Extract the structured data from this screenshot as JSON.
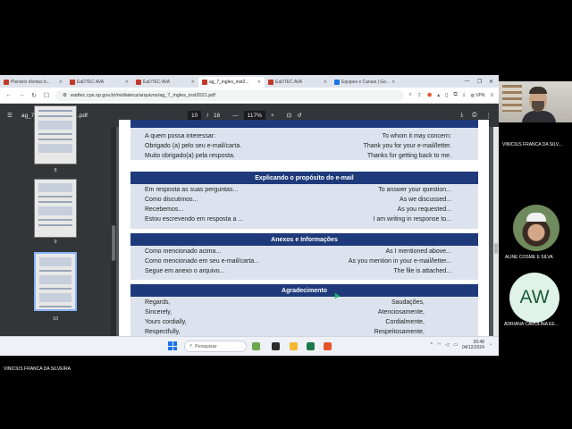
{
  "browser": {
    "tabs": [
      {
        "label": "Plenário dívidas b...",
        "active": false
      },
      {
        "label": "EaDTEC AVA",
        "active": false
      },
      {
        "label": "EaDTEC AVA",
        "active": false
      },
      {
        "label": "ag_7_ingles_inst2...",
        "active": true
      },
      {
        "label": "EaDTEC AVA",
        "active": false
      },
      {
        "label": "Equipes e Canais | Ge...",
        "active": false
      }
    ],
    "url": "eadtec.cps.sp.gov.br/midiateca/arquivos/ag_7_ingles_inst2021.pdf",
    "vpn_label": "VPN"
  },
  "pdf_viewer": {
    "file_name": "ag_7_ingles_inst2021.pdf",
    "current_page": "10",
    "page_separator": "/",
    "total_pages": "16",
    "zoom": "117%",
    "thumbnails": [
      {
        "label": "8"
      },
      {
        "label": "9"
      },
      {
        "label": "10"
      }
    ]
  },
  "document": {
    "sections": [
      {
        "heading": "",
        "rows": [
          {
            "pt": "A quem possa interessar:",
            "en": "To whom it may concern:"
          },
          {
            "pt": "Obrigado (a) pelo seu e-mail/carta.",
            "en": "Thank you for your e-mail/letter."
          },
          {
            "pt": "Muito obrigado(a) pela resposta.",
            "en": "Thanks for getting back to me."
          }
        ]
      },
      {
        "heading": "Explicando o propósito do e-mail",
        "rows": [
          {
            "pt": "Em resposta as suas perguntas...",
            "en": "To answer your question..."
          },
          {
            "pt": "Como discutimos...",
            "en": "As we discussed..."
          },
          {
            "pt": "Recebemos...",
            "en": "As you requested..."
          },
          {
            "pt": "Estou escrevendo em resposta a ...",
            "en": "I am writing in response to..."
          }
        ]
      },
      {
        "heading": "Anexos e Informações",
        "rows": [
          {
            "pt": "Como mencionado acima...",
            "en": "As I mentioned above..."
          },
          {
            "pt": "Como mencionado em seu e-mail/carta...",
            "en": "As you mention in your e-mail/letter..."
          },
          {
            "pt": "Segue em anexo o arquivo...",
            "en": "The file is attached..."
          }
        ]
      },
      {
        "heading": "Agradecimento",
        "rows": [
          {
            "pt": "Regards,",
            "en": "Saudações,"
          },
          {
            "pt": "Sincerely,",
            "en": "Atenciosamente,"
          },
          {
            "pt": "Yours cordially,",
            "en": "Cordialmente,"
          },
          {
            "pt": "Respectfully,",
            "en": "Respeitosamente,"
          }
        ]
      }
    ]
  },
  "taskbar": {
    "search_placeholder": "Pesquisar",
    "time": "20:48",
    "date": "04/12/2024"
  },
  "meeting": {
    "presenter_label": "VINICIUS FRANCA DA SILVEIRA",
    "participants": [
      {
        "name": "VINICIUS FRANCA DA SILV...",
        "type": "video"
      },
      {
        "name": "ALINE COSME E SILVA",
        "type": "photo"
      },
      {
        "name": "ADRIANA CAROLINA EE...",
        "type": "initials",
        "initials": "AW"
      }
    ]
  },
  "colors": {
    "section_header": "#1f3a7a",
    "band": "#dde3ee",
    "pdf_toolbar": "#323639"
  }
}
